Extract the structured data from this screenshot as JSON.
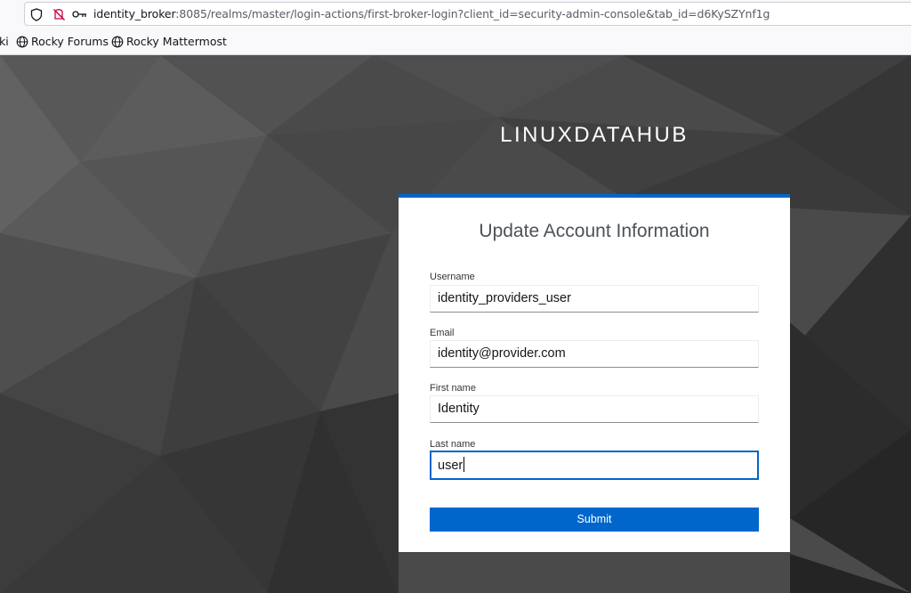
{
  "browser": {
    "url_host": "identity_broker",
    "url_rest": ":8085/realms/master/login-actions/first-broker-login?client_id=security-admin-console&tab_id=d6KySZYnf1g",
    "icons": [
      "shield-icon",
      "permissions-blocked-icon",
      "key-icon"
    ]
  },
  "bookmarks": {
    "partial_label": "ki",
    "items": [
      {
        "label": "Rocky Forums",
        "icon": "globe-icon"
      },
      {
        "label": "Rocky Mattermost",
        "icon": "globe-icon"
      }
    ]
  },
  "page": {
    "brand": "LINUXDATAHUB",
    "title": "Update Account Information",
    "fields": {
      "username": {
        "label": "Username",
        "value": "identity_providers_user"
      },
      "email": {
        "label": "Email",
        "value": "identity@provider.com"
      },
      "first_name": {
        "label": "First name",
        "value": "Identity"
      },
      "last_name": {
        "label": "Last name",
        "value": "user"
      }
    },
    "submit_label": "Submit",
    "colors": {
      "accent": "#0066cc",
      "background": "#4a4a4a"
    }
  }
}
